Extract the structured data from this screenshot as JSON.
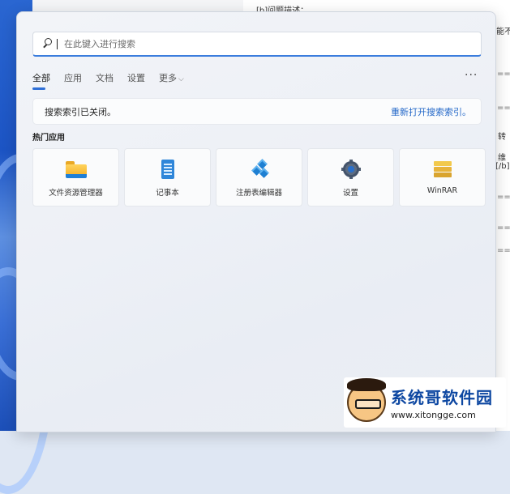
{
  "background_doc": {
    "fragments": [
      "[b]问题描述：",
      "能不",
      "转",
      "维",
      "[/b]"
    ]
  },
  "search": {
    "placeholder": "在此键入进行搜索",
    "icon": "search-icon"
  },
  "tabs": [
    {
      "label": "全部",
      "active": true
    },
    {
      "label": "应用",
      "active": false
    },
    {
      "label": "文档",
      "active": false
    },
    {
      "label": "设置",
      "active": false
    },
    {
      "label": "更多",
      "active": false
    }
  ],
  "more_options_icon": "ellipsis-icon",
  "notice": {
    "text": "搜索索引已关闭。",
    "link": "重新打开搜索索引。"
  },
  "section": {
    "title": "热门应用"
  },
  "apps": [
    {
      "label": "文件资源管理器",
      "icon": "folder-icon"
    },
    {
      "label": "记事本",
      "icon": "notepad-icon"
    },
    {
      "label": "注册表编辑器",
      "icon": "registry-editor-icon"
    },
    {
      "label": "设置",
      "icon": "gear-icon"
    },
    {
      "label": "WinRAR",
      "icon": "winrar-icon"
    }
  ],
  "watermark": {
    "name": "系统哥软件园",
    "url": "www.xitongge.com"
  },
  "colors": {
    "accent": "#2f6fd6",
    "link": "#2468c8",
    "panel_bg": "#eef1f6"
  }
}
